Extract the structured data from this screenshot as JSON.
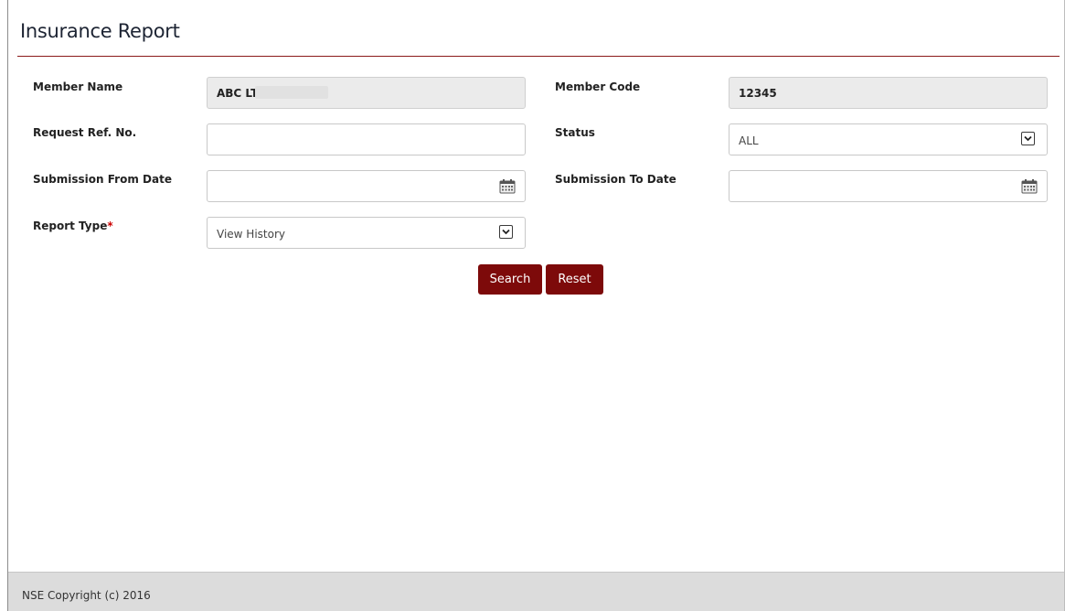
{
  "page": {
    "title": "Insurance Report"
  },
  "form": {
    "member_name": {
      "label": "Member Name",
      "value": "ABC LTD"
    },
    "member_code": {
      "label": "Member Code",
      "value": "12345"
    },
    "request_ref_no": {
      "label": "Request Ref. No.",
      "value": ""
    },
    "status": {
      "label": "Status",
      "value": "ALL"
    },
    "submission_from_date": {
      "label": "Submission From Date",
      "value": "",
      "icon": "calendar-icon"
    },
    "submission_to_date": {
      "label": "Submission To Date",
      "value": "",
      "icon": "calendar-icon"
    },
    "report_type": {
      "label": "Report Type",
      "required_marker": "*",
      "value": "View History"
    }
  },
  "buttons": {
    "search": "Search",
    "reset": "Reset"
  },
  "footer": {
    "copyright": "NSE Copyright (c) 2016"
  },
  "colors": {
    "accent": "#7d0a0a",
    "title_rule": "#8b1a1a",
    "footer_bg": "#dcdcdc",
    "readonly_bg": "#ebebeb"
  }
}
